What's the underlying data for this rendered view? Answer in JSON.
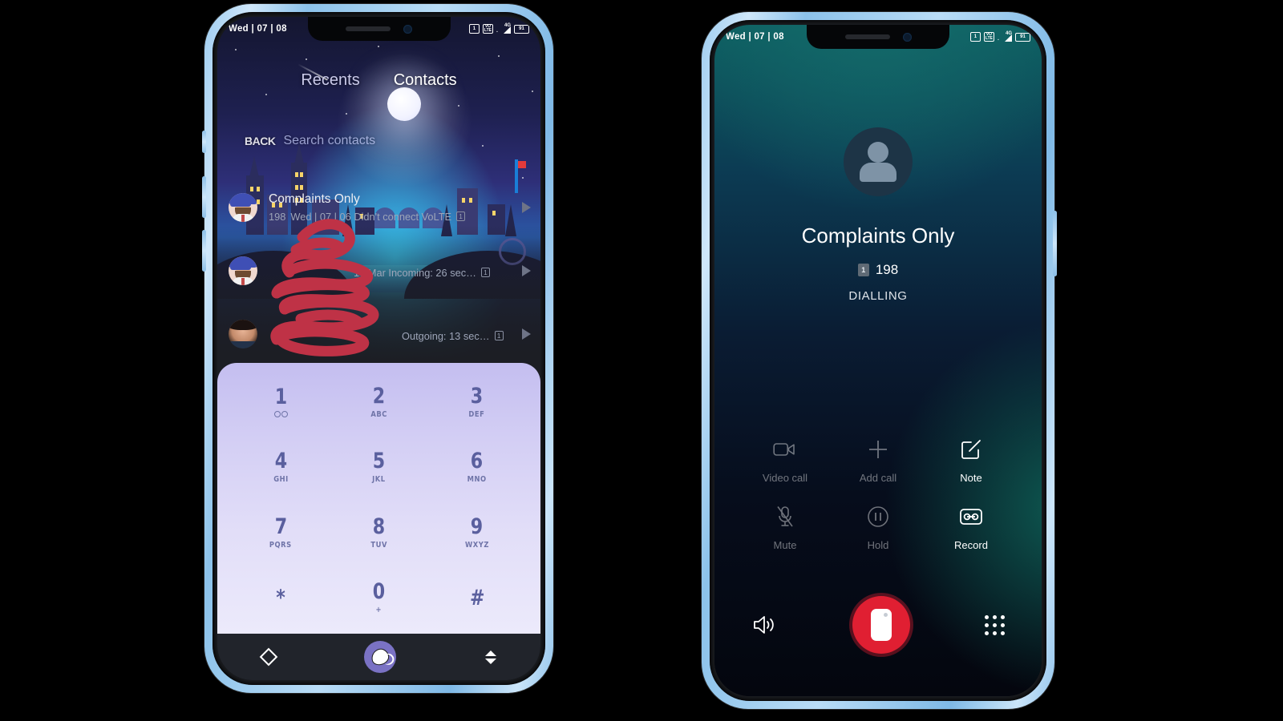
{
  "scene": {
    "background_color": "#000000",
    "device_frame_color": "#9fcdf0"
  },
  "left_phone": {
    "app": "Dialer",
    "status_bar": {
      "time": "Wed | 07 | 08",
      "icons": [
        "sim-1-icon",
        "volte-icon",
        "signal-4g-icon",
        "battery-icon"
      ],
      "sim_label": "1",
      "volte_label_top": "VO",
      "volte_label_bottom": "LTE",
      "network_label": "4G",
      "battery_label": "91"
    },
    "tabs": [
      {
        "label": "Recents",
        "active": false
      },
      {
        "label": "Contacts",
        "active": true
      }
    ],
    "search": {
      "back_label": "BACK",
      "placeholder": "Search contacts"
    },
    "call_log": [
      {
        "name": "Complaints Only",
        "number": "198",
        "detail": "Wed | 07 | 06 Didn't connect VoLTE",
        "sim": "1",
        "avatar": "cartoon",
        "redacted": false
      },
      {
        "name": "",
        "number": "",
        "detail": "10 Mar Incoming: 26 sec…",
        "sim": "1",
        "avatar": "cartoon",
        "redacted": true
      },
      {
        "name": "",
        "number": "",
        "detail": "Outgoing: 13 sec…",
        "sim": "1",
        "avatar": "photo",
        "redacted": true
      }
    ],
    "dialpad": {
      "accent_color": "#5a5f9e",
      "background_top": "#c4bef0",
      "background_bottom": "#eceafb",
      "keys": [
        {
          "digit": "1",
          "letters": "",
          "glyph": "voicemail-icon"
        },
        {
          "digit": "2",
          "letters": "ABC",
          "glyph": ""
        },
        {
          "digit": "3",
          "letters": "DEF",
          "glyph": ""
        },
        {
          "digit": "4",
          "letters": "GHI",
          "glyph": ""
        },
        {
          "digit": "5",
          "letters": "JKL",
          "glyph": ""
        },
        {
          "digit": "6",
          "letters": "MNO",
          "glyph": ""
        },
        {
          "digit": "7",
          "letters": "PQRS",
          "glyph": ""
        },
        {
          "digit": "8",
          "letters": "TUV",
          "glyph": ""
        },
        {
          "digit": "9",
          "letters": "WXYZ",
          "glyph": ""
        },
        {
          "digit": "*",
          "letters": "",
          "glyph": ""
        },
        {
          "digit": "0",
          "letters": "+",
          "glyph": ""
        },
        {
          "digit": "#",
          "letters": "",
          "glyph": ""
        }
      ]
    },
    "nav_bar": {
      "back": "back-diamond-icon",
      "home": "home-glove-icon",
      "recents": "chevron-updown-icon",
      "home_color": "#7a72c4"
    }
  },
  "right_phone": {
    "app": "In-call screen",
    "status_bar": {
      "time": "Wed | 07 | 08",
      "sim_label": "1",
      "volte_label_top": "VO",
      "volte_label_bottom": "LTE",
      "network_label": "4G",
      "battery_label": "91"
    },
    "callee": {
      "name": "Complaints Only",
      "sim": "1",
      "number": "198",
      "status": "DIALLING",
      "avatar": "person-placeholder-icon"
    },
    "actions": [
      {
        "label": "Video call",
        "icon": "video-call-icon",
        "enabled": false
      },
      {
        "label": "Add call",
        "icon": "add-call-icon",
        "enabled": false
      },
      {
        "label": "Note",
        "icon": "note-icon",
        "enabled": true
      },
      {
        "label": "Mute",
        "icon": "mute-icon",
        "enabled": false
      },
      {
        "label": "Hold",
        "icon": "hold-icon",
        "enabled": false
      },
      {
        "label": "Record",
        "icon": "record-icon",
        "enabled": true
      }
    ],
    "bottom_bar": {
      "speaker": "speaker-icon",
      "end_call": "end-call-icon",
      "keypad": "keypad-dots-icon",
      "end_call_color": "#e01f32"
    }
  }
}
